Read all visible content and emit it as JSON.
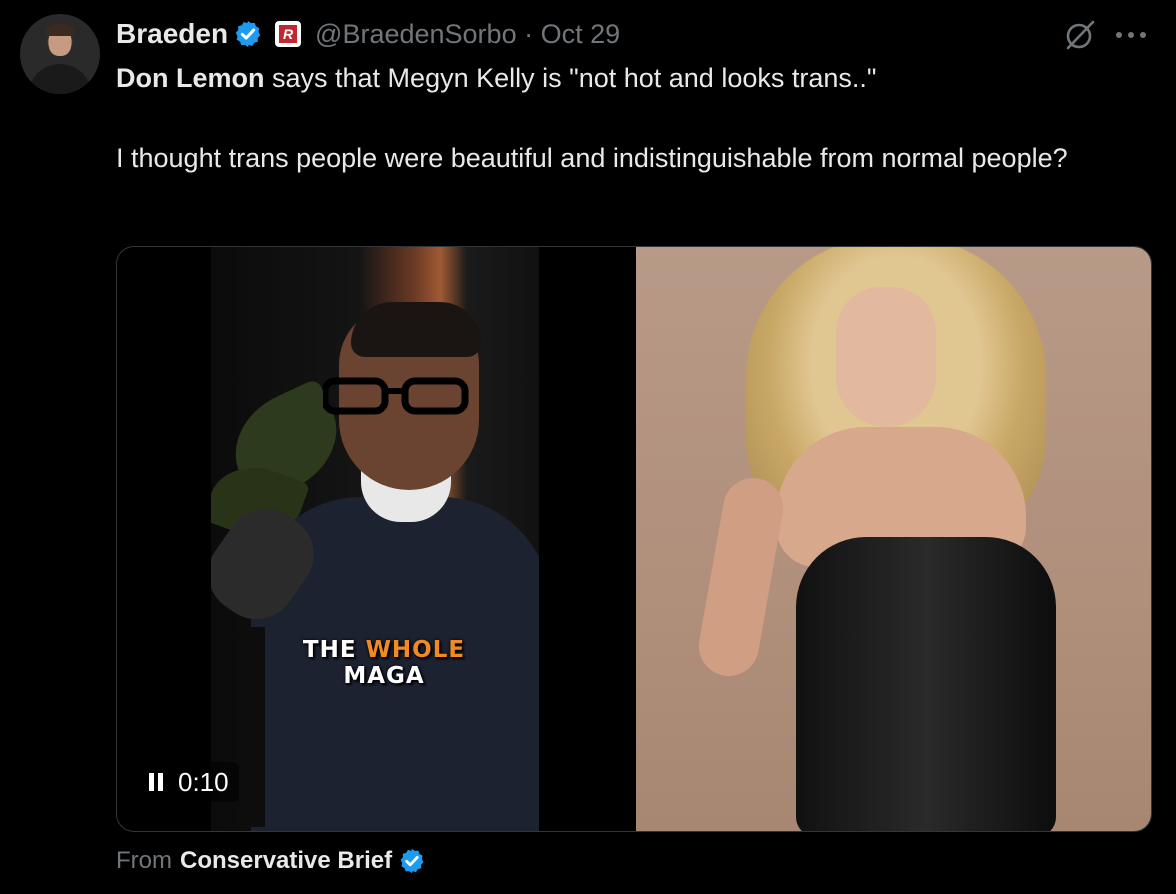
{
  "author": {
    "name": "Braeden",
    "handle": "@BraedenSorbo",
    "separator": "·",
    "date": "Oct 29",
    "affiliate_badge_text": "R"
  },
  "tweet": {
    "mention": "Don Lemon",
    "line1_rest": " says that Megyn Kelly is \"not hot and looks trans..\"",
    "para2": "I thought trans people were beautiful and indistinguishable from normal people?"
  },
  "media": {
    "caption_words": [
      "THE",
      "WHOLE",
      "MAGA"
    ],
    "time": "0:10"
  },
  "attribution": {
    "label": "From",
    "source": "Conservative Brief"
  },
  "colors": {
    "background": "#000000",
    "text": "#e7e9ea",
    "muted": "#71767b",
    "verified_blue": "#1d9bf0",
    "caption_accent": "#f28a22"
  },
  "icons": [
    "verified-badge-icon",
    "affiliate-badge-icon",
    "grok-icon",
    "more-options-icon",
    "pause-icon"
  ]
}
